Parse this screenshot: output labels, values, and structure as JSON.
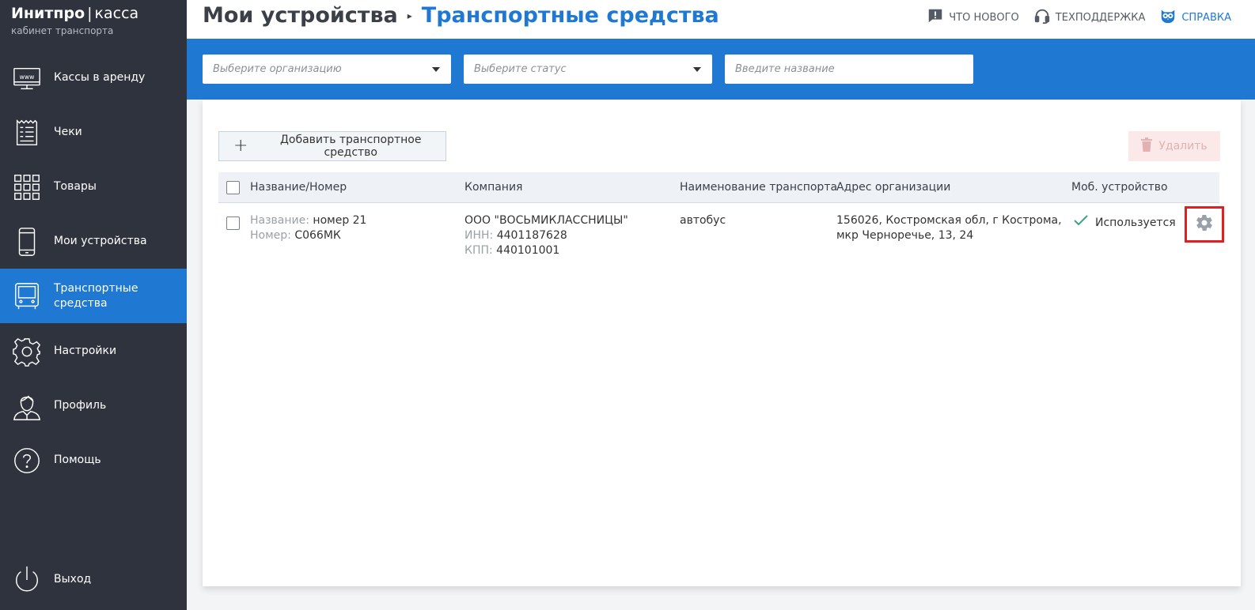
{
  "brand": {
    "name_bold": "Инитпро",
    "separator": "|",
    "name_light": "касса",
    "subtitle": "кабинет транспорта"
  },
  "sidebar": {
    "items": [
      {
        "label": "Кассы в аренду",
        "icon": "monitor-www-icon"
      },
      {
        "label": "Чеки",
        "icon": "receipt-icon"
      },
      {
        "label": "Товары",
        "icon": "grid-icon"
      },
      {
        "label": "Мои устройства",
        "icon": "phone-icon"
      },
      {
        "label": "Транспортные средства",
        "icon": "bus-icon",
        "active": true
      },
      {
        "label": "Настройки",
        "icon": "gear-icon"
      },
      {
        "label": "Профиль",
        "icon": "user-icon"
      },
      {
        "label": "Помощь",
        "icon": "help-icon"
      }
    ],
    "logout": {
      "label": "Выход",
      "icon": "power-icon"
    }
  },
  "header": {
    "title_root": "Мои устройства",
    "title_sep": "▸",
    "title_current": "Транспортные средства",
    "links": {
      "whats_new": "ЧТО НОВОГО",
      "support": "ТЕХПОДДЕРЖКА",
      "help": "СПРАВКА"
    }
  },
  "filters": {
    "organization_placeholder": "Выберите организацию",
    "status_placeholder": "Выберите статус",
    "name_placeholder": "Введите название"
  },
  "toolbar": {
    "add_label": "Добавить транспортное средство",
    "delete_label": "Удалить"
  },
  "table": {
    "columns": [
      "Название/Номер",
      "Компания",
      "Наименование транспорта",
      "Адрес организации",
      "Моб. устройство"
    ],
    "rows": [
      {
        "name_label": "Название:",
        "name_value": "номер 21",
        "number_label": "Номер:",
        "number_value": "С066МК",
        "company": "ООО \"ВОСЬМИКЛАССНИЦЫ\"",
        "inn_label": "ИНН:",
        "inn_value": "4401187628",
        "kpp_label": "КПП:",
        "kpp_value": "440101001",
        "transport": "автобус",
        "address_line1": "156026, Костромская обл, г Кострома,",
        "address_line2": "мкр Черноречье, 13, 24",
        "device_status": "Используется"
      }
    ]
  },
  "colors": {
    "sidebar": "#2e333d",
    "accent": "#1f78d1",
    "highlight": "#e02020",
    "success": "#3aa57a"
  }
}
